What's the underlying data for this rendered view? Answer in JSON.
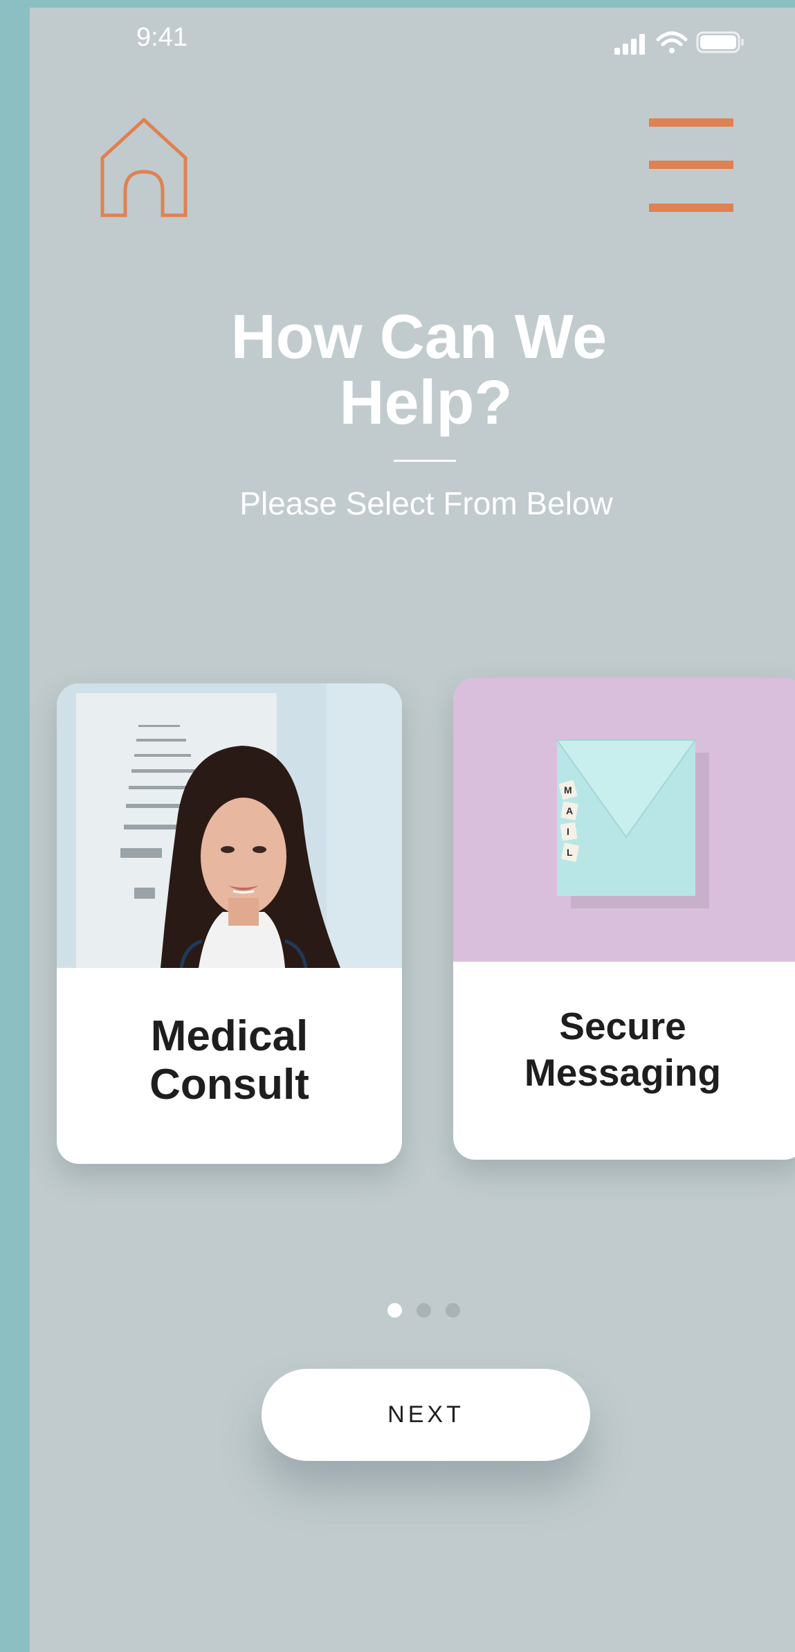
{
  "status_bar": {
    "time": "9:41"
  },
  "header": {
    "home_icon": "home-icon",
    "menu_icon": "hamburger-menu-icon",
    "accent_color": "#df8152"
  },
  "main": {
    "title_line1": "How Can We",
    "title_line2": "Help?",
    "subtitle": "Please Select From Below"
  },
  "cards": [
    {
      "label_line1": "Medical",
      "label_line2": "Consult",
      "image": "doctor-photo"
    },
    {
      "label_line1": "Secure",
      "label_line2": "Messaging",
      "image": "envelope-mail-photo"
    }
  ],
  "pagination": {
    "total": 3,
    "active": 1,
    "active_color": "#ffffff",
    "inactive_color": "#a9b3b5"
  },
  "footer": {
    "next_label": "NEXT"
  },
  "colors": {
    "screen_bg": "#c1cbcd",
    "frame_bg": "#8bbfc1"
  }
}
